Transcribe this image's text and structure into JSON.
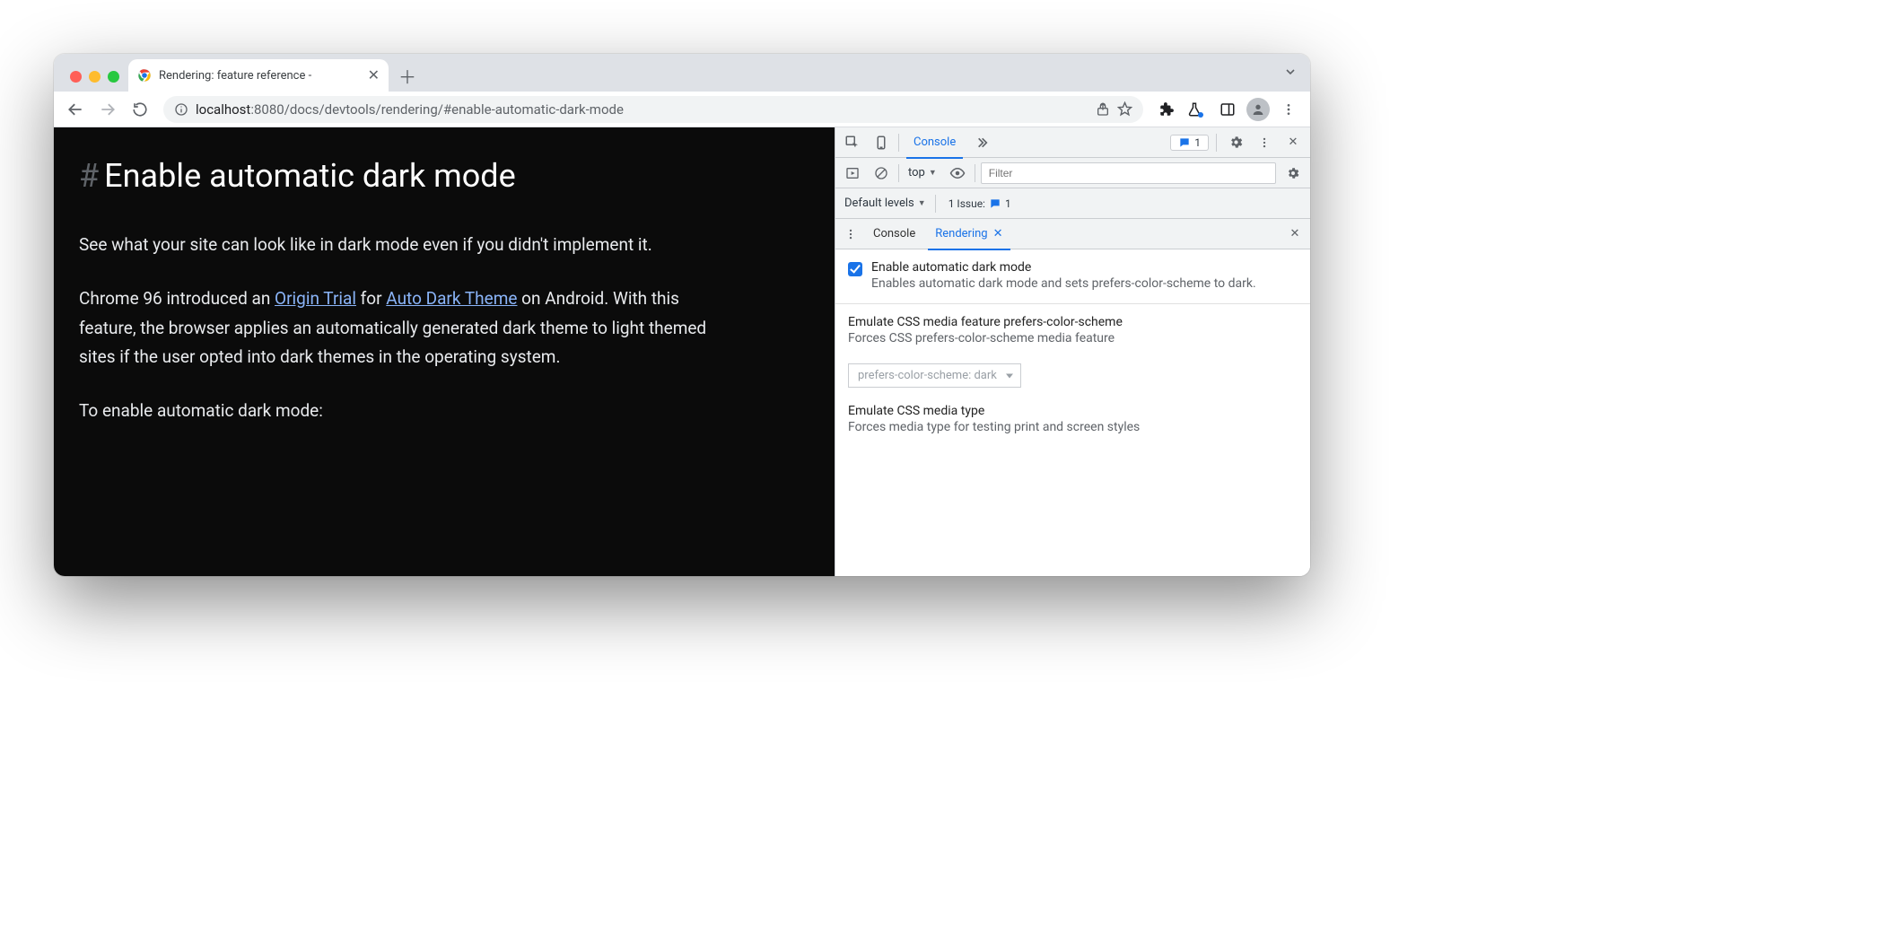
{
  "browser": {
    "tab_title": "Rendering: feature reference -",
    "url_host": "localhost",
    "url_port": ":8080",
    "url_path": "/docs/devtools/rendering/#enable-automatic-dark-mode"
  },
  "page": {
    "heading": "Enable automatic dark mode",
    "p1": "See what your site can look like in dark mode even if you didn't implement it.",
    "p2_a": "Chrome 96 introduced an ",
    "p2_link1": "Origin Trial",
    "p2_b": " for ",
    "p2_link2": "Auto Dark Theme",
    "p2_c": " on Android. With this feature, the browser applies an automatically generated dark theme to light themed sites if the user opted into dark themes in the operating system.",
    "p3": "To enable automatic dark mode:"
  },
  "devtools": {
    "main_tab": "Console",
    "issues_badge": "1",
    "context": "top",
    "filter_placeholder": "Filter",
    "levels_label": "Default levels",
    "issue_label": "1 Issue:",
    "issue_count": "1",
    "drawer_tabs": {
      "console": "Console",
      "rendering": "Rendering"
    },
    "sections": {
      "dark": {
        "title": "Enable automatic dark mode",
        "desc": "Enables automatic dark mode and sets prefers-color-scheme to dark."
      },
      "pcs": {
        "title": "Emulate CSS media feature prefers-color-scheme",
        "desc": "Forces CSS prefers-color-scheme media feature",
        "select_value": "prefers-color-scheme: dark"
      },
      "media": {
        "title": "Emulate CSS media type",
        "desc": "Forces media type for testing print and screen styles"
      }
    }
  }
}
